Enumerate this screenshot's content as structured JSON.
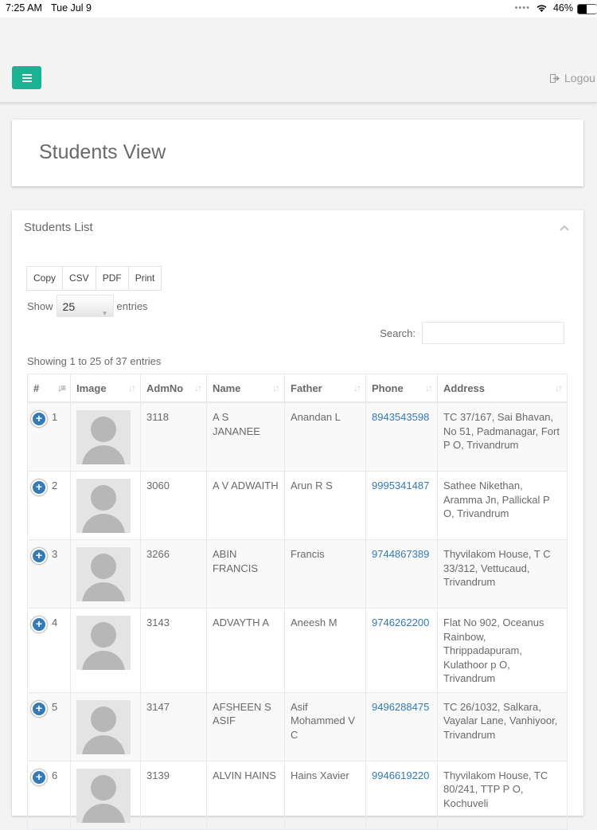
{
  "status_bar": {
    "time": "7:25 AM",
    "date": "Tue Jul 9",
    "battery": "46%"
  },
  "navbar": {
    "logout_label": "Logou"
  },
  "page": {
    "title": "Students View"
  },
  "panel": {
    "title": "Students List",
    "export_buttons": [
      "Copy",
      "CSV",
      "PDF",
      "Print"
    ],
    "show_label": "Show",
    "page_size": "25",
    "entries_label": "entries",
    "search_label": "Search:",
    "info": "Showing 1 to 25 of 37 entries"
  },
  "table": {
    "columns": [
      "#",
      "Image",
      "AdmNo",
      "Name",
      "Father",
      "Phone",
      "Address"
    ],
    "rows": [
      {
        "no": "1",
        "admno": "3118",
        "name": "A S JANANEE",
        "father": "Anandan L",
        "phone": "8943543598",
        "address": "TC 37/167, Sai Bhavan, No 51, Padmanagar, Fort P O, Trivandrum"
      },
      {
        "no": "2",
        "admno": "3060",
        "name": "A V ADWAITH",
        "father": "Arun R S",
        "phone": "9995341487",
        "address": "Sathee Nikethan, Aramma Jn, Pallickal P O, Trivandrum"
      },
      {
        "no": "3",
        "admno": "3266",
        "name": "ABIN FRANCIS",
        "father": "Francis",
        "phone": "9744867389",
        "address": "Thyvilakom House, T C 33/312, Vettucaud, Trivandrum"
      },
      {
        "no": "4",
        "admno": "3143",
        "name": "ADVAYTH A",
        "father": "Aneesh M",
        "phone": "9746262200",
        "address": "Flat No 902, Oceanus Rainbow, Thrippadapuram, Kulathoor p O, Trivandrum"
      },
      {
        "no": "5",
        "admno": "3147",
        "name": "AFSHEEN S ASIF",
        "father": "Asif Mohammed V C",
        "phone": "9496288475",
        "address": "TC 26/1032, Salkara, Vayalar Lane, Vanhiyoor, Trivandrum"
      },
      {
        "no": "6",
        "admno": "3139",
        "name": "ALVIN HAINS",
        "father": "Hains Xavier",
        "phone": "9946619220",
        "address": "Thyvilakom House, TC 80/241, TTP P O, Kochuveli"
      }
    ]
  },
  "colors": {
    "accent": "#1ab394",
    "link": "#337ab7",
    "text": "#676a6c"
  }
}
